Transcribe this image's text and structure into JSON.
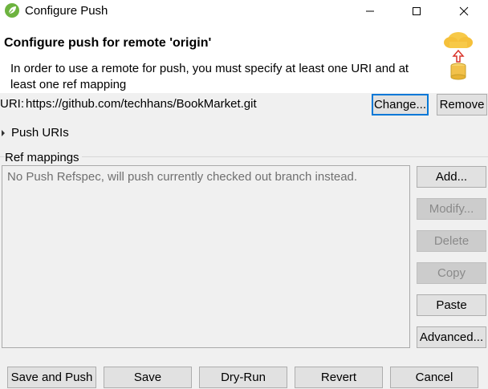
{
  "window": {
    "title": "Configure Push",
    "icon": "spring-leaf-icon"
  },
  "header": {
    "title": "Configure push for remote 'origin'",
    "description": "In order to use a remote for push, you must specify at least one URI and at least one ref mapping",
    "icon": "cloud-upload-database-icon"
  },
  "uri": {
    "label": "URI:",
    "value": "https://github.com/techhans/BookMarket.git",
    "change_label": "Change...",
    "remove_label": "Remove"
  },
  "push_uris": {
    "label": "Push URIs",
    "expanded": false
  },
  "ref_mappings": {
    "label": "Ref mappings",
    "empty_message": "No Push Refspec, will push currently checked out branch instead.",
    "buttons": {
      "add": "Add...",
      "modify": "Modify...",
      "delete": "Delete",
      "copy": "Copy",
      "paste": "Paste",
      "advanced": "Advanced..."
    }
  },
  "footer": {
    "save_and_push": "Save and Push",
    "save": "Save",
    "dry_run": "Dry-Run",
    "revert": "Revert",
    "cancel": "Cancel"
  },
  "colors": {
    "focus_border": "#0078d7",
    "button_bg": "#e1e1e1",
    "disabled_text": "#8a8a8a"
  }
}
